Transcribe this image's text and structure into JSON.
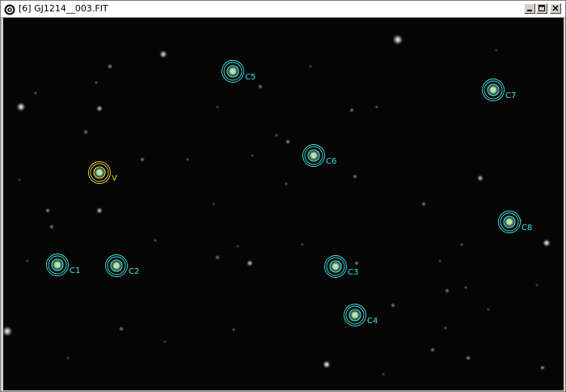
{
  "window": {
    "title": "[6] GJ1214__003.FIT",
    "icon": "app-logo-icon",
    "controls": [
      "minimize-icon",
      "maximize-icon",
      "close-icon"
    ]
  },
  "colors": {
    "background": "#050505",
    "comparison_aperture": "#39e6e6",
    "variable_aperture": "#e6d63a",
    "star_core": "#9cf59c"
  },
  "apertures": [
    {
      "label": "V",
      "kind": "variable"
    },
    {
      "label": "C1",
      "kind": "comparison"
    },
    {
      "label": "C2",
      "kind": "comparison"
    },
    {
      "label": "C3",
      "kind": "comparison"
    },
    {
      "label": "C4",
      "kind": "comparison"
    },
    {
      "label": "C5",
      "kind": "comparison"
    },
    {
      "label": "C6",
      "kind": "comparison"
    },
    {
      "label": "C7",
      "kind": "comparison"
    },
    {
      "label": "C8",
      "kind": "comparison"
    }
  ]
}
